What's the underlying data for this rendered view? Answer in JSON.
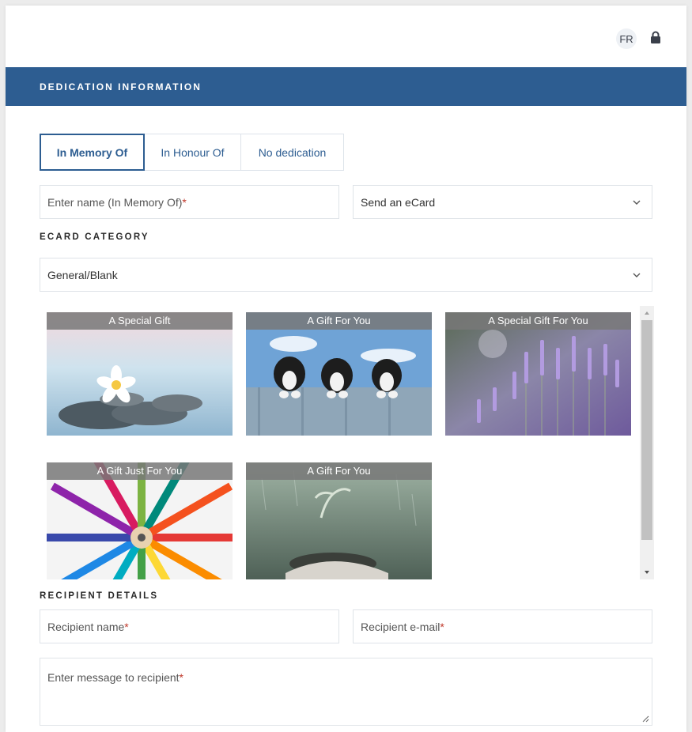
{
  "header": {
    "lang_label": "FR"
  },
  "section_title": "DEDICATION INFORMATION",
  "dedication_tabs": [
    {
      "label": "In Memory Of",
      "active": true
    },
    {
      "label": "In Honour Of",
      "active": false
    },
    {
      "label": "No dedication",
      "active": false
    }
  ],
  "dedication_name": {
    "placeholder": "Enter name (In Memory Of)",
    "required_mark": "*"
  },
  "ecard_select": {
    "value": "Send an eCard"
  },
  "ecard_category": {
    "label": "ECARD CATEGORY",
    "value": "General/Blank"
  },
  "ecards": [
    {
      "caption": "A Special Gift",
      "icon": "spa-stones-flower-image"
    },
    {
      "caption": "A Gift For You",
      "icon": "puppies-fence-image"
    },
    {
      "caption": "A Special Gift For You",
      "icon": "lavender-field-image"
    },
    {
      "caption": "A Gift Just For You",
      "icon": "colored-pencils-image"
    },
    {
      "caption": "A Gift For You",
      "icon": "seedling-hands-image"
    }
  ],
  "recipient": {
    "label": "RECIPIENT DETAILS",
    "name_placeholder": "Recipient name",
    "email_placeholder": "Recipient e-mail",
    "message_placeholder": "Enter message to recipient",
    "required_mark": "*"
  },
  "colors": {
    "brand_blue": "#2d5d91",
    "required_red": "#c0392b"
  }
}
